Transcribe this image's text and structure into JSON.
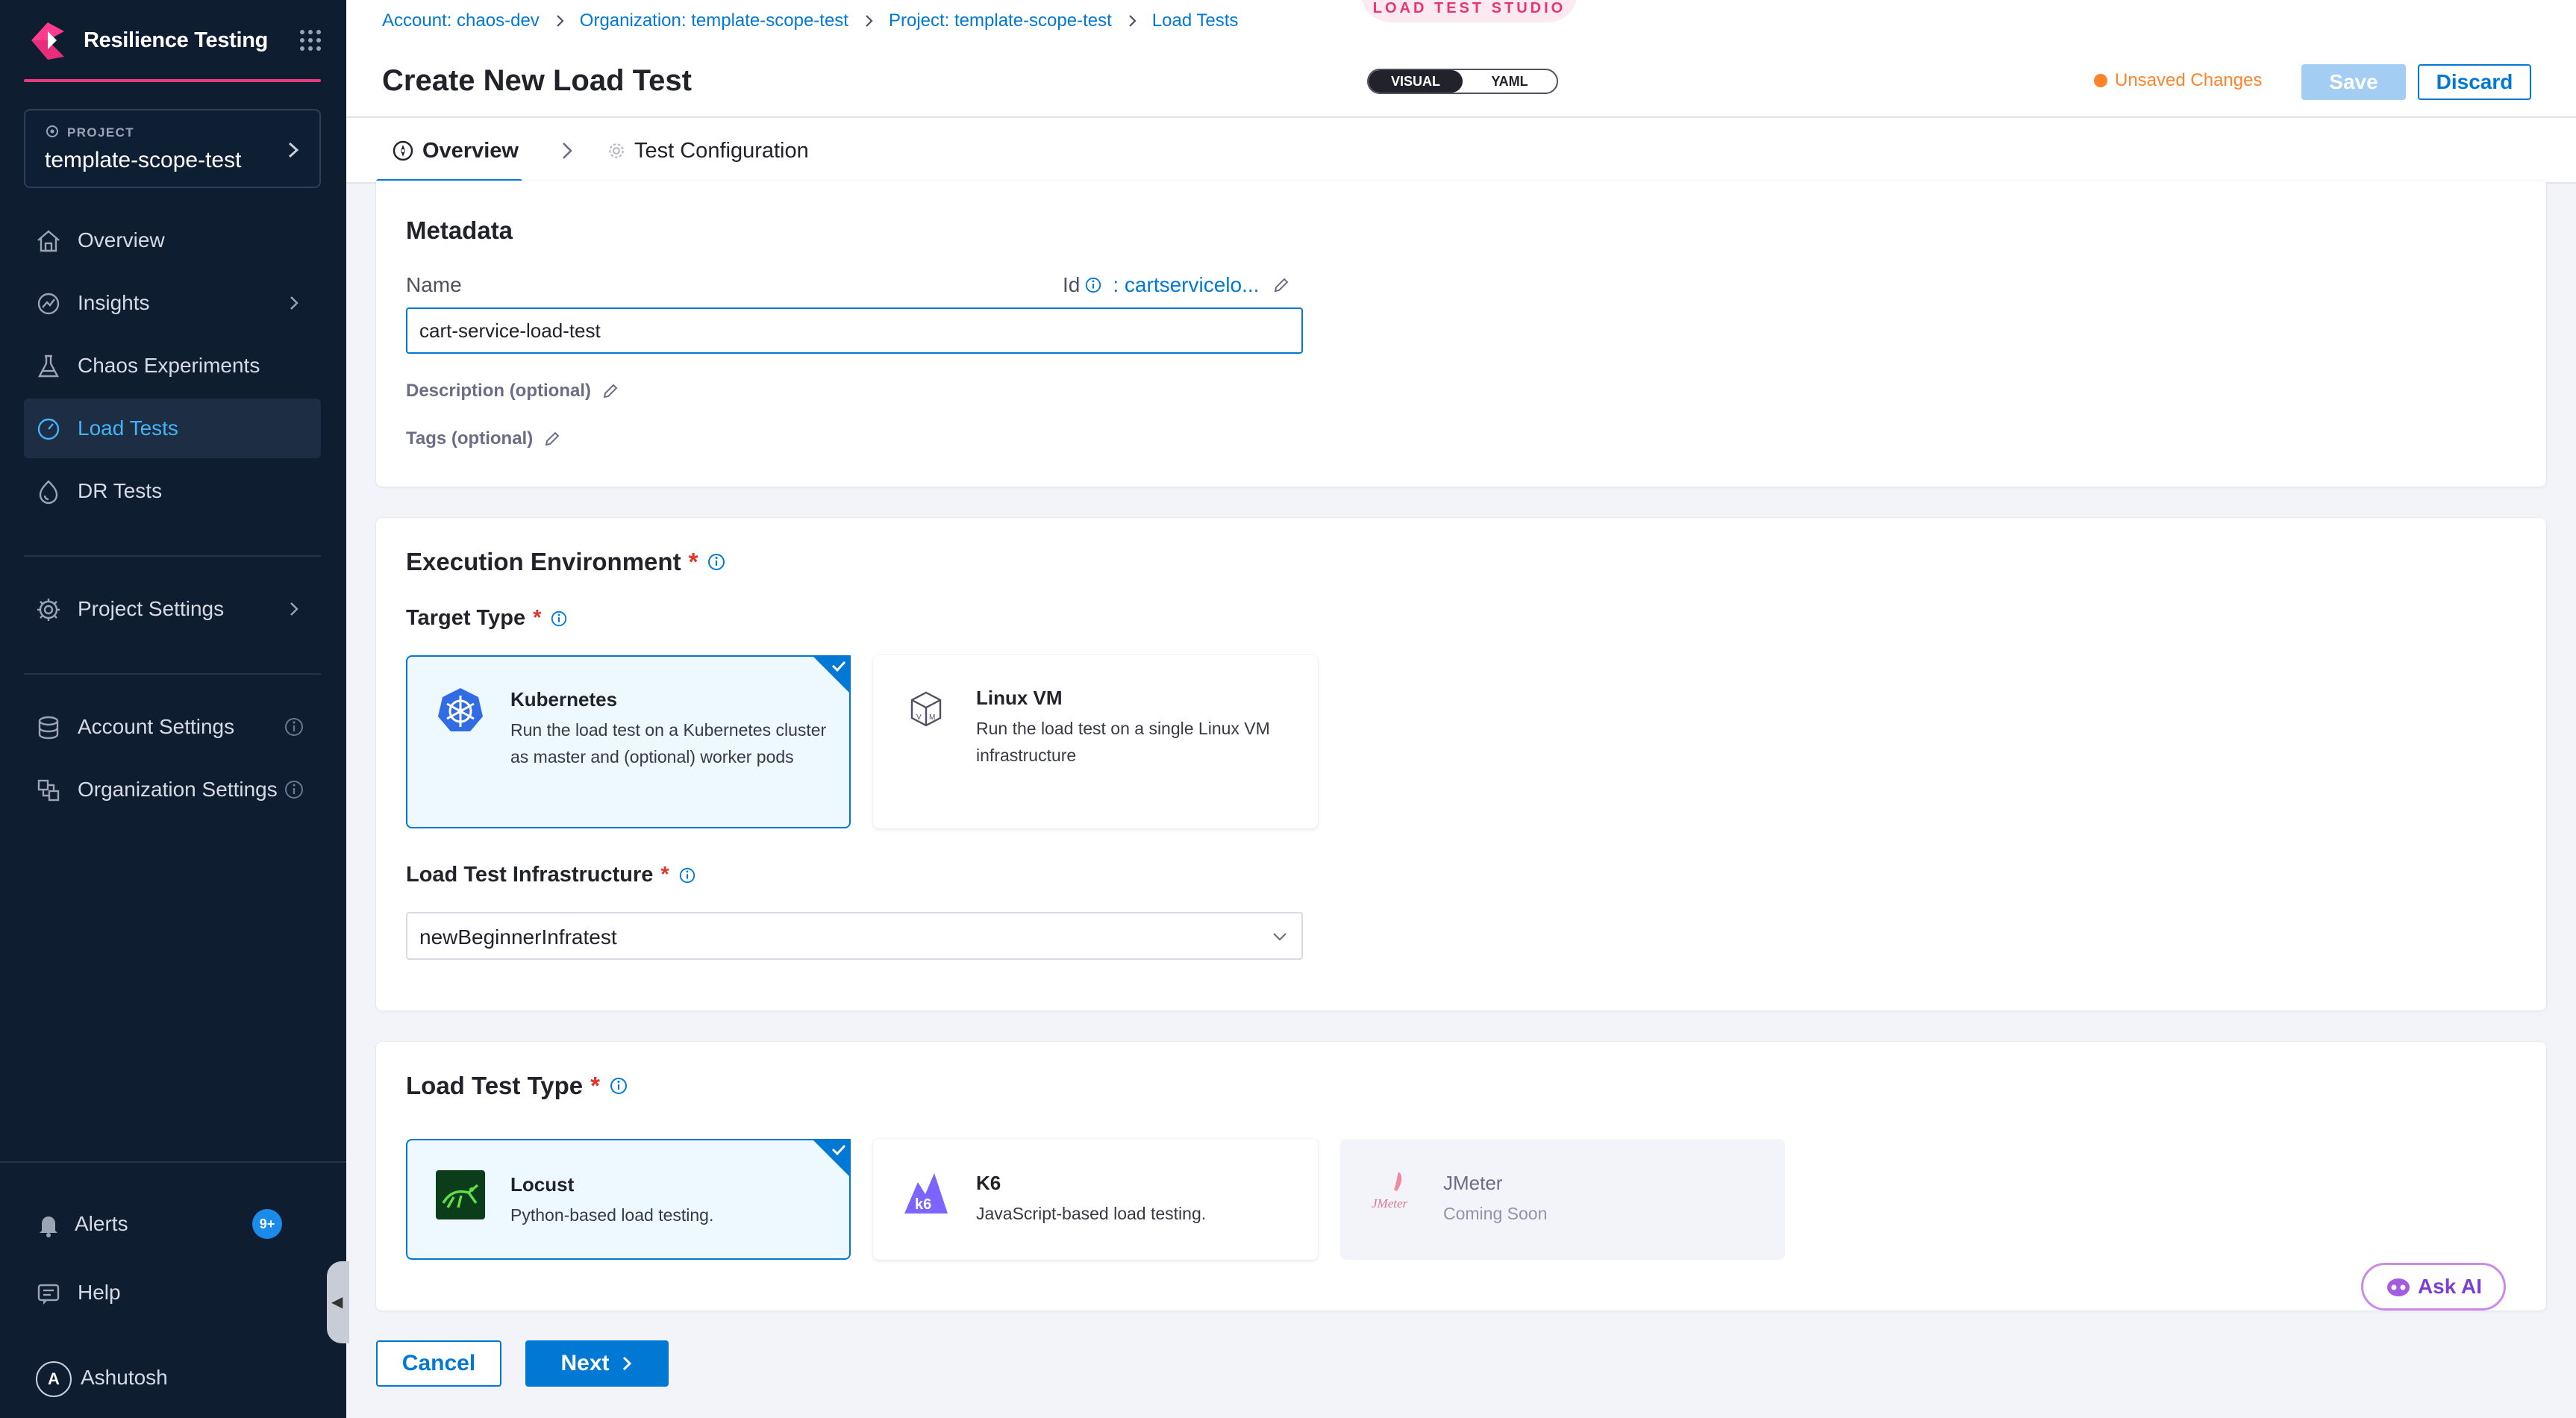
{
  "sidebar": {
    "app_title": "Resilience Testing",
    "project_caption": "PROJECT",
    "project_name": "template-scope-test",
    "items": [
      {
        "label": "Overview",
        "icon": "home-icon"
      },
      {
        "label": "Insights",
        "icon": "insights-icon"
      },
      {
        "label": "Chaos Experiments",
        "icon": "flask-icon"
      },
      {
        "label": "Load Tests",
        "icon": "gauge-icon",
        "active": true
      },
      {
        "label": "DR Tests",
        "icon": "dr-icon"
      }
    ],
    "project_settings": "Project Settings",
    "account_settings": "Account Settings",
    "organization_settings": "Organization Settings",
    "alerts": "Alerts",
    "alerts_badge": "9+",
    "help": "Help",
    "user_initial": "A",
    "user_name": "Ashutosh"
  },
  "header": {
    "breadcrumb": [
      "Account: chaos-dev",
      "Organization: template-scope-test",
      "Project: template-scope-test",
      "Load Tests"
    ],
    "studio_label": "LOAD TEST STUDIO",
    "title": "Create New Load Test",
    "toggle": {
      "visual": "VISUAL",
      "yaml": "YAML",
      "active": "VISUAL"
    },
    "unsaved": "Unsaved Changes",
    "save": "Save",
    "discard": "Discard"
  },
  "tabs": {
    "overview": "Overview",
    "config": "Test Configuration"
  },
  "metadata": {
    "title": "Metadata",
    "name_label": "Name",
    "id_label": "Id",
    "id_value": ": cartservicelo...",
    "name_value": "cart-service-load-test",
    "description_label": "Description (optional)",
    "tags_label": "Tags (optional)"
  },
  "execution": {
    "title": "Execution Environment",
    "required": "*",
    "target_type_label": "Target Type",
    "targets": [
      {
        "title": "Kubernetes",
        "desc": "Run the load test on a Kubernetes cluster as master and (optional) worker pods",
        "selected": true
      },
      {
        "title": "Linux VM",
        "desc": "Run the load test on a single Linux VM infrastructure",
        "selected": false
      }
    ],
    "infra_label": "Load Test Infrastructure",
    "infra_value": "newBeginnerInfratest"
  },
  "load_type": {
    "title": "Load Test Type",
    "types": [
      {
        "title": "Locust",
        "desc": "Python-based load testing.",
        "selected": true
      },
      {
        "title": "K6",
        "desc": "JavaScript-based load testing.",
        "selected": false
      },
      {
        "title": "JMeter",
        "desc": "Coming Soon",
        "disabled": true
      }
    ]
  },
  "ask_ai": "Ask AI",
  "footer": {
    "cancel": "Cancel",
    "next": "Next"
  },
  "colors": {
    "sidebar_bg": "#0e1d30",
    "primary": "#0278d5",
    "accent_pink": "#e83a7d",
    "unsaved_orange": "#ff832b",
    "required_red": "#e43326"
  }
}
